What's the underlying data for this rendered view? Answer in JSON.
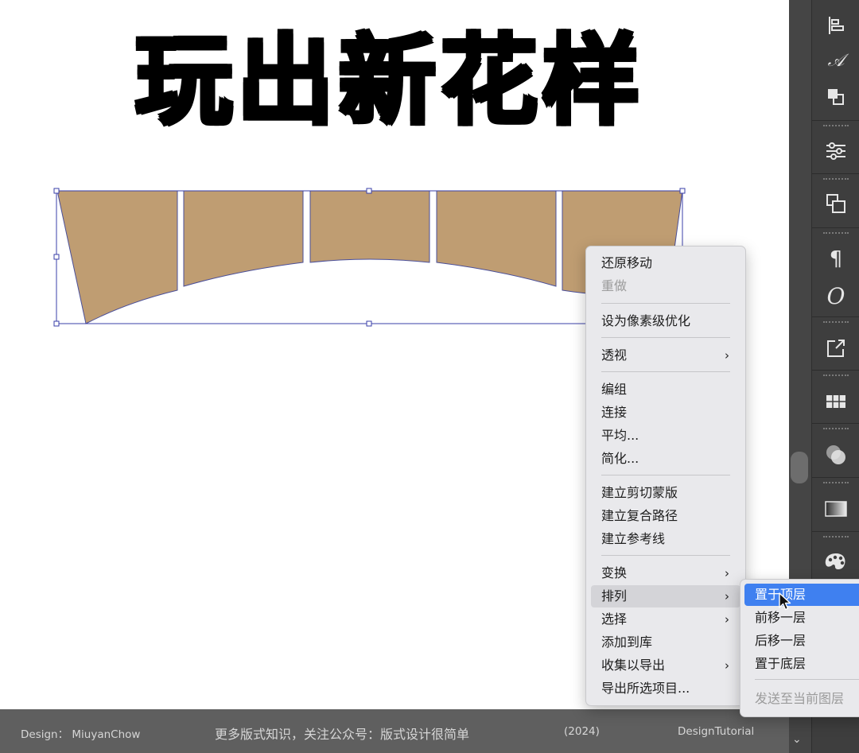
{
  "canvas": {
    "headline": "玩出新花样",
    "shape_fill": "#bf9d72",
    "selection_color": "#3a3fa8"
  },
  "context_menu": {
    "items": [
      {
        "label": "还原移动",
        "disabled": false
      },
      {
        "label": "重做",
        "disabled": true
      },
      {
        "label": "设为像素级优化"
      },
      {
        "label": "透视",
        "submenu": true
      },
      {
        "label": "编组"
      },
      {
        "label": "连接"
      },
      {
        "label": "平均..."
      },
      {
        "label": "简化..."
      },
      {
        "label": "建立剪切蒙版"
      },
      {
        "label": "建立复合路径"
      },
      {
        "label": "建立参考线"
      },
      {
        "label": "变换",
        "submenu": true
      },
      {
        "label": "排列",
        "submenu": true,
        "hovered": true
      },
      {
        "label": "选择",
        "submenu": true
      },
      {
        "label": "添加到库"
      },
      {
        "label": "收集以导出",
        "submenu": true
      },
      {
        "label": "导出所选项目..."
      }
    ],
    "submenu_arrow": "›"
  },
  "arrange_submenu": {
    "items": [
      {
        "label": "置于顶层",
        "active": true
      },
      {
        "label": "前移一层"
      },
      {
        "label": "后移一层"
      },
      {
        "label": "置于底层"
      },
      {
        "label": "发送至当前图层",
        "disabled": true
      }
    ]
  },
  "footer": {
    "design": "Design： MiuyanChow",
    "promo": "更多版式知识，关注公众号：版式设计很简单",
    "year": "(2024)",
    "brand": "DesignTutorial"
  },
  "right_panel": {
    "icons": [
      "align-icon",
      "character-style-icon",
      "pathfinder-icon",
      "properties-icon",
      "artboards-icon",
      "paragraph-icon",
      "opentype-icon",
      "export-icon",
      "symbols-icon",
      "transparency-icon",
      "gradient-icon",
      "color-guide-icon"
    ],
    "glyphs": {
      "character": "𝒜",
      "paragraph": "¶",
      "opentype": "O",
      "export": "⇱",
      "scroll_chevron": "⌄"
    }
  }
}
